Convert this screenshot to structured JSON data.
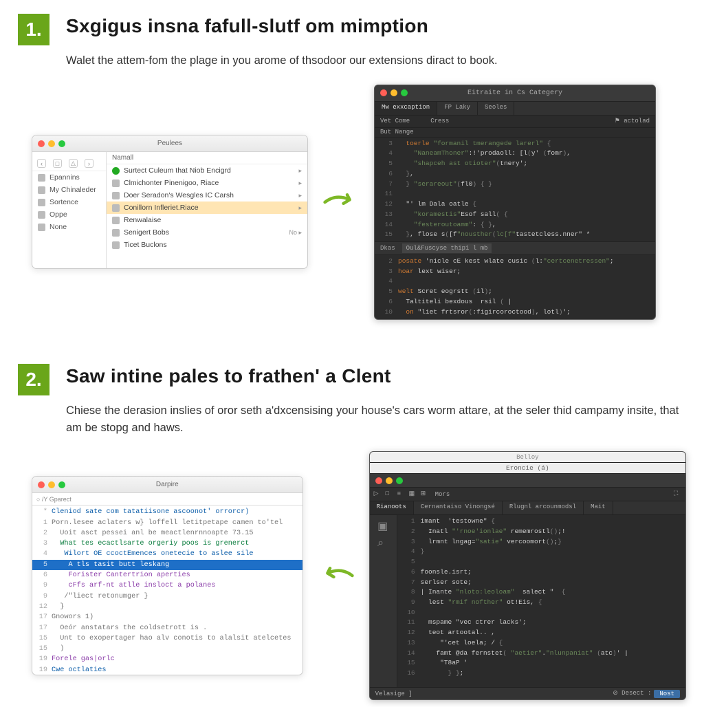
{
  "step1": {
    "num": "1.",
    "title": "Sxgigus insna fafull-slutf om mimption",
    "desc": "Walet the attem-fom the plage in you arome of thsodoor our extensions diract to book.",
    "finder": {
      "title": "Peulees",
      "sidebar": [
        "Epannins",
        "My Chinaleder",
        "Sortence",
        "Oppe",
        "None"
      ],
      "toolbar_label": "Namall",
      "rows": [
        {
          "label": "Surtect Culeum that Niob Encigrd",
          "hi": false,
          "chev": "▸",
          "check": true
        },
        {
          "label": "Clmichonter Pinenigoo, Riace",
          "hi": false,
          "chev": "▸"
        },
        {
          "label": "Doer Seradon's Wesgles IC Carsh",
          "hi": false,
          "chev": "▸"
        },
        {
          "label": "Conillorn Infleriet.Riace",
          "hi": true,
          "chev": "▸"
        },
        {
          "label": "Renwalaise",
          "hi": false,
          "chev": ""
        },
        {
          "label": "Senigert Bobs",
          "hi": false,
          "chev": "No ▸"
        },
        {
          "label": "Ticet Buclons",
          "hi": false,
          "chev": ""
        }
      ]
    },
    "editor": {
      "title": "Eitraite in Cs Categery",
      "tabs": [
        "Mw exxcaption",
        "FP Laky",
        "Seoles"
      ],
      "sub_left": [
        "Vet Come",
        "But Nange"
      ],
      "sub_mid": "Cress",
      "sub_right": "⚑ actolad",
      "top_code": [
        {
          "n": "3",
          "t": "  toerle \"formanil tmerangede larerl\" {"
        },
        {
          "n": "4",
          "t": "    \"NaneamThoner\":!'prodaoll: [l(y' (fomr),"
        },
        {
          "n": "5",
          "t": "    \"shapceh ast otioter\"(tnery';"
        },
        {
          "n": "6",
          "t": "  },"
        },
        {
          "n": "7",
          "t": "  } \"serareout\"(fl0) { }"
        },
        {
          "n": "11",
          "t": ""
        },
        {
          "n": "12",
          "t": "  \"' lm Dala oatle {"
        },
        {
          "n": "13",
          "t": "    \"koramestis\"Esof sall( {"
        },
        {
          "n": "14",
          "t": "    \"festeroutoamm\": { },"
        },
        {
          "n": "15",
          "t": "  }, flose s([f\"nousther(lc[f\"tastetcless.nner\" *"
        }
      ],
      "split_tabs": [
        "Dkas",
        "Oul&Fuscyse thip1 l mb"
      ],
      "bottom_code": [
        {
          "n": "2",
          "t": "posate 'nicle cE kest wlate cusic (l:\"certcenetressen\";"
        },
        {
          "n": "3",
          "t": "hoar lext wiser;"
        },
        {
          "n": "4",
          "t": ""
        },
        {
          "n": "5",
          "t": "welt Scret eogrstt (il);"
        },
        {
          "n": "6",
          "t": "  Taltiteli bexdous  rsil ( |"
        },
        {
          "n": "10",
          "t": "  on \"liet frtsror(:figircoroctood), lotl)';"
        }
      ]
    }
  },
  "step2": {
    "num": "2.",
    "title": "Saw intine pales to frathen' a Clent",
    "desc": "Chiese the derasion inslies of oror seth a'dxcensising your house's cars worm attare, at the seler thid campamy insite, that am be stopg and haws.",
    "light_editor": {
      "title": "Darpire",
      "tab_left": "○ /Y Gparect",
      "lines": [
        {
          "n": "*",
          "t": "Cleniod sate com tatatiisone ascoonot' orrorcr)",
          "cls": "c2"
        },
        {
          "n": "1",
          "t": "Porn.lesee aclaters w} loffell letitpetape camen to'tel",
          "cls": "c4"
        },
        {
          "n": "2",
          "t": "  Uoit asct pessei anl be meactlenrnnoapte 73.15",
          "cls": "c4"
        },
        {
          "n": "3",
          "t": "  What tes ecactlsarte orgeriy poos is grenerct",
          "cls": "c1"
        },
        {
          "n": "4",
          "t": "   Wilort OE ccoctEmences onetecie to aslee sile",
          "cls": "c2"
        },
        {
          "n": "5",
          "t": "    A tls tasit butt leskang",
          "sel": true
        },
        {
          "n": "6",
          "t": "    Forister Cantertrion aperties",
          "cls": "c3"
        },
        {
          "n": "9",
          "t": "    cFfs arf-nt atlle insloct a polanes",
          "cls": "c3"
        },
        {
          "n": "9",
          "t": "   /\"liect retonumger }",
          "cls": "c4"
        },
        {
          "n": "12",
          "t": "  }",
          "cls": "c4"
        },
        {
          "n": "17",
          "t": "Gnowors 1)",
          "cls": "c4"
        },
        {
          "n": "17",
          "t": "  Oeór anstatars the coldsetrott is .",
          "cls": "c4"
        },
        {
          "n": "15",
          "t": "  Unt to exopertager hao alv conotis to alalsit atelcetes",
          "cls": "c4"
        },
        {
          "n": "15",
          "t": "  )",
          "cls": "c4"
        },
        {
          "n": "19",
          "t": "Forele gas|orlc",
          "cls": "c3"
        },
        {
          "n": "19",
          "t": "Cwe octlaties",
          "cls": "c2"
        }
      ]
    },
    "dark_editor": {
      "title_small": "Belloy",
      "title": "Eroncie (á)",
      "toolbar_icons": [
        "□",
        "≡",
        "□",
        "▦",
        "⊞",
        "Mors",
        "⛶"
      ],
      "tabs": [
        "Rianoots",
        "Cernantaiso Vinongsé",
        "Rlugnl arcounmodsl",
        "Mait"
      ],
      "lines": [
        {
          "n": "1",
          "t": "imant  'testowne\" {"
        },
        {
          "n": "2",
          "t": "  Inatl \"'rnoe'ionlae\" rememrostl();!"
        },
        {
          "n": "3",
          "t": "  lrmnt lngag=\"satie\" vercoomort();}"
        },
        {
          "n": "4",
          "t": "}"
        },
        {
          "n": "5",
          "t": ""
        },
        {
          "n": "6",
          "t": "foonsle.isrt;"
        },
        {
          "n": "7",
          "t": "serlser sote;"
        },
        {
          "n": "8",
          "t": "| Inante \"nloto:leoloam\"  salect \"  {"
        },
        {
          "n": "9",
          "t": "  lest \"rmif nofther\" ot!Eis, {"
        },
        {
          "n": "10",
          "t": ""
        },
        {
          "n": "11",
          "t": "  mspame \"vec ctrer lacks';"
        },
        {
          "n": "12",
          "t": "  teot artootal.. ,"
        },
        {
          "n": "13",
          "t": "     \"'cet loela; / {"
        },
        {
          "n": "14",
          "t": "    famt @da fernstet( \"aetier\".\"nlunpaniat\" (atc)' |"
        },
        {
          "n": "15",
          "t": "     \"T8aP '"
        },
        {
          "n": "16",
          "t": "       } };"
        }
      ],
      "footer_tab": "Velasige ]",
      "footer_stat": "⊘ Desect :",
      "footer_btn": "Nost"
    }
  }
}
